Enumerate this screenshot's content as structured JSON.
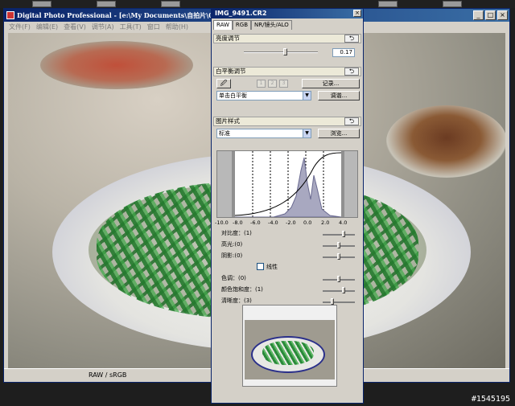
{
  "main_window": {
    "title": "Digital Photo Professional - [e:\\My Documents\\自拍片\\0605-10\\",
    "menu": [
      "文件(F)",
      "编辑(E)",
      "查看(V)",
      "调节(A)",
      "工具(T)",
      "窗口",
      "帮助(H)"
    ],
    "status": "RAW / sRGB"
  },
  "palette": {
    "title": "IMG_9491.CR2",
    "tabs": [
      "RAW",
      "RGB",
      "NR/镜头/ALO"
    ],
    "brightness": {
      "header": "亮度调节",
      "value": "0.17",
      "level": 0.55
    },
    "white_balance": {
      "header": "白平衡调节",
      "presets": [
        "1",
        "2",
        "3"
      ],
      "record_label": "记录...",
      "mode_value": "单击白平衡",
      "adjust_label": "调谐..."
    },
    "picture_style": {
      "header": "图片样式",
      "style_value": "标准",
      "browse_label": "浏览..."
    },
    "histogram_axis": [
      "-10.0",
      "-8.0",
      "-6.0",
      "-4.0",
      "-2.0",
      "0.0",
      "2.0",
      "4.0"
    ],
    "params": [
      {
        "label": "对比度：(1)",
        "level": 0.65
      },
      {
        "label": "高光:(0)",
        "level": 0.5
      },
      {
        "label": "阴影:(0)",
        "level": 0.5
      },
      {
        "label": "色调：(0)",
        "level": 0.5
      },
      {
        "label": "颜色饱和度：(1)",
        "level": 0.65
      },
      {
        "label": "清晰度：(3)",
        "level": 0.3
      }
    ],
    "linear_label": "线性"
  },
  "watermark": "#1545195",
  "icons": {
    "undo": "undo-icon",
    "close": "close-icon",
    "eyedropper": "eyedropper-icon",
    "dropdown": "chevron-down-icon"
  }
}
